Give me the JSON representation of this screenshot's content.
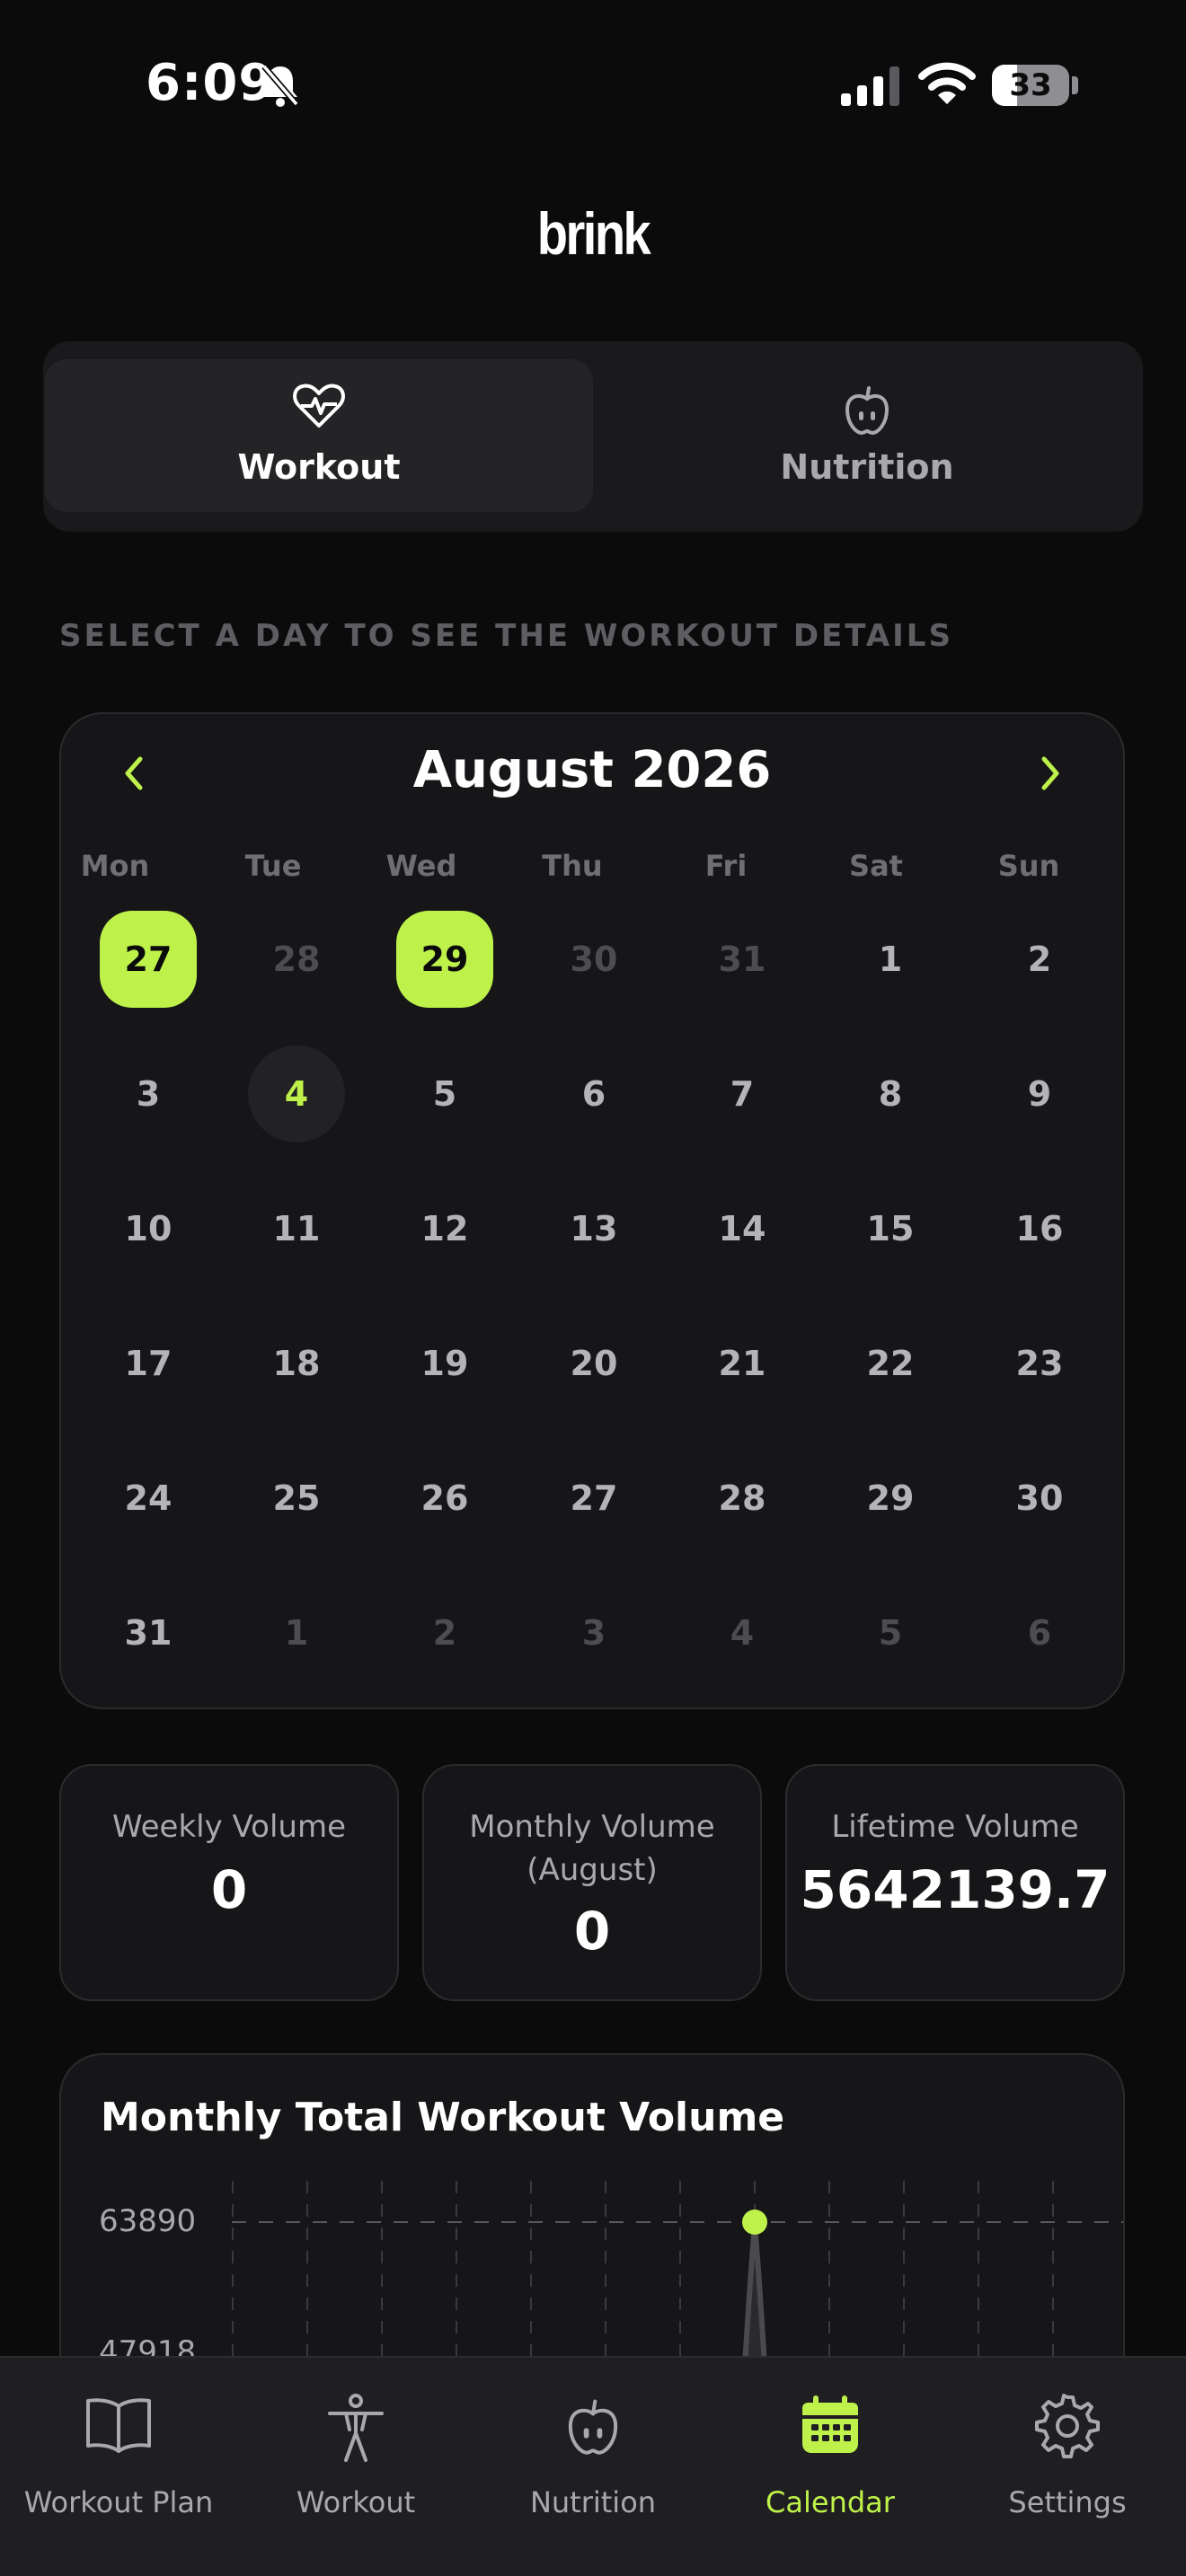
{
  "status_bar": {
    "time": "6:09",
    "battery": "33",
    "battery_level": 0.33
  },
  "logo": "brink",
  "segment": {
    "tabs": [
      {
        "label": "Workout",
        "icon": "heart-pulse-icon",
        "active": true
      },
      {
        "label": "Nutrition",
        "icon": "apple-icon",
        "active": false
      }
    ]
  },
  "hint": "SELECT A DAY TO SEE THE WORKOUT DETAILS",
  "calendar": {
    "month": "August 2026",
    "weekdays": [
      "Mon",
      "Tue",
      "Wed",
      "Thu",
      "Fri",
      "Sat",
      "Sun"
    ],
    "weeks": [
      [
        {
          "d": "27",
          "s": "selected"
        },
        {
          "d": "28",
          "s": "dim"
        },
        {
          "d": "29",
          "s": "selected"
        },
        {
          "d": "30",
          "s": "dim"
        },
        {
          "d": "31",
          "s": "dim"
        },
        {
          "d": "1",
          "s": "normal"
        },
        {
          "d": "2",
          "s": "normal"
        }
      ],
      [
        {
          "d": "3",
          "s": "normal"
        },
        {
          "d": "4",
          "s": "today"
        },
        {
          "d": "5",
          "s": "normal"
        },
        {
          "d": "6",
          "s": "normal"
        },
        {
          "d": "7",
          "s": "normal"
        },
        {
          "d": "8",
          "s": "normal"
        },
        {
          "d": "9",
          "s": "normal"
        }
      ],
      [
        {
          "d": "10",
          "s": "normal"
        },
        {
          "d": "11",
          "s": "normal"
        },
        {
          "d": "12",
          "s": "normal"
        },
        {
          "d": "13",
          "s": "normal"
        },
        {
          "d": "14",
          "s": "normal"
        },
        {
          "d": "15",
          "s": "normal"
        },
        {
          "d": "16",
          "s": "normal"
        }
      ],
      [
        {
          "d": "17",
          "s": "normal"
        },
        {
          "d": "18",
          "s": "normal"
        },
        {
          "d": "19",
          "s": "normal"
        },
        {
          "d": "20",
          "s": "normal"
        },
        {
          "d": "21",
          "s": "normal"
        },
        {
          "d": "22",
          "s": "normal"
        },
        {
          "d": "23",
          "s": "normal"
        }
      ],
      [
        {
          "d": "24",
          "s": "normal"
        },
        {
          "d": "25",
          "s": "normal"
        },
        {
          "d": "26",
          "s": "normal"
        },
        {
          "d": "27",
          "s": "normal"
        },
        {
          "d": "28",
          "s": "normal"
        },
        {
          "d": "29",
          "s": "normal"
        },
        {
          "d": "30",
          "s": "normal"
        }
      ],
      [
        {
          "d": "31",
          "s": "normal"
        },
        {
          "d": "1",
          "s": "dim"
        },
        {
          "d": "2",
          "s": "dim"
        },
        {
          "d": "3",
          "s": "dim"
        },
        {
          "d": "4",
          "s": "dim"
        },
        {
          "d": "5",
          "s": "dim"
        },
        {
          "d": "6",
          "s": "dim"
        }
      ]
    ]
  },
  "stats": {
    "weekly": {
      "label": "Weekly Volume",
      "value": "0"
    },
    "monthly": {
      "label_line1": "Monthly Volume",
      "label_line2": "(August)",
      "value": "0"
    },
    "lifetime": {
      "label": "Lifetime Volume",
      "value": "5642139.7"
    }
  },
  "chart": {
    "title": "Monthly Total Workout Volume",
    "y_labels": [
      "63890",
      "47918"
    ]
  },
  "chart_data": {
    "type": "area",
    "title": "Monthly Total Workout Volume",
    "yticks": [
      63890,
      47918
    ],
    "peak_value": 63890
  },
  "colors": {
    "accent": "#bef24a",
    "background": "#0b0b0c",
    "card": "#161618",
    "muted_text": "#a9a9ad"
  },
  "tab_bar": {
    "items": [
      {
        "label": "Workout Plan",
        "icon": "book-icon",
        "active": false
      },
      {
        "label": "Workout",
        "icon": "person-icon",
        "active": false
      },
      {
        "label": "Nutrition",
        "icon": "apple-icon",
        "active": false
      },
      {
        "label": "Calendar",
        "icon": "calendar-icon",
        "active": true
      },
      {
        "label": "Settings",
        "icon": "gear-icon",
        "active": false
      }
    ]
  }
}
